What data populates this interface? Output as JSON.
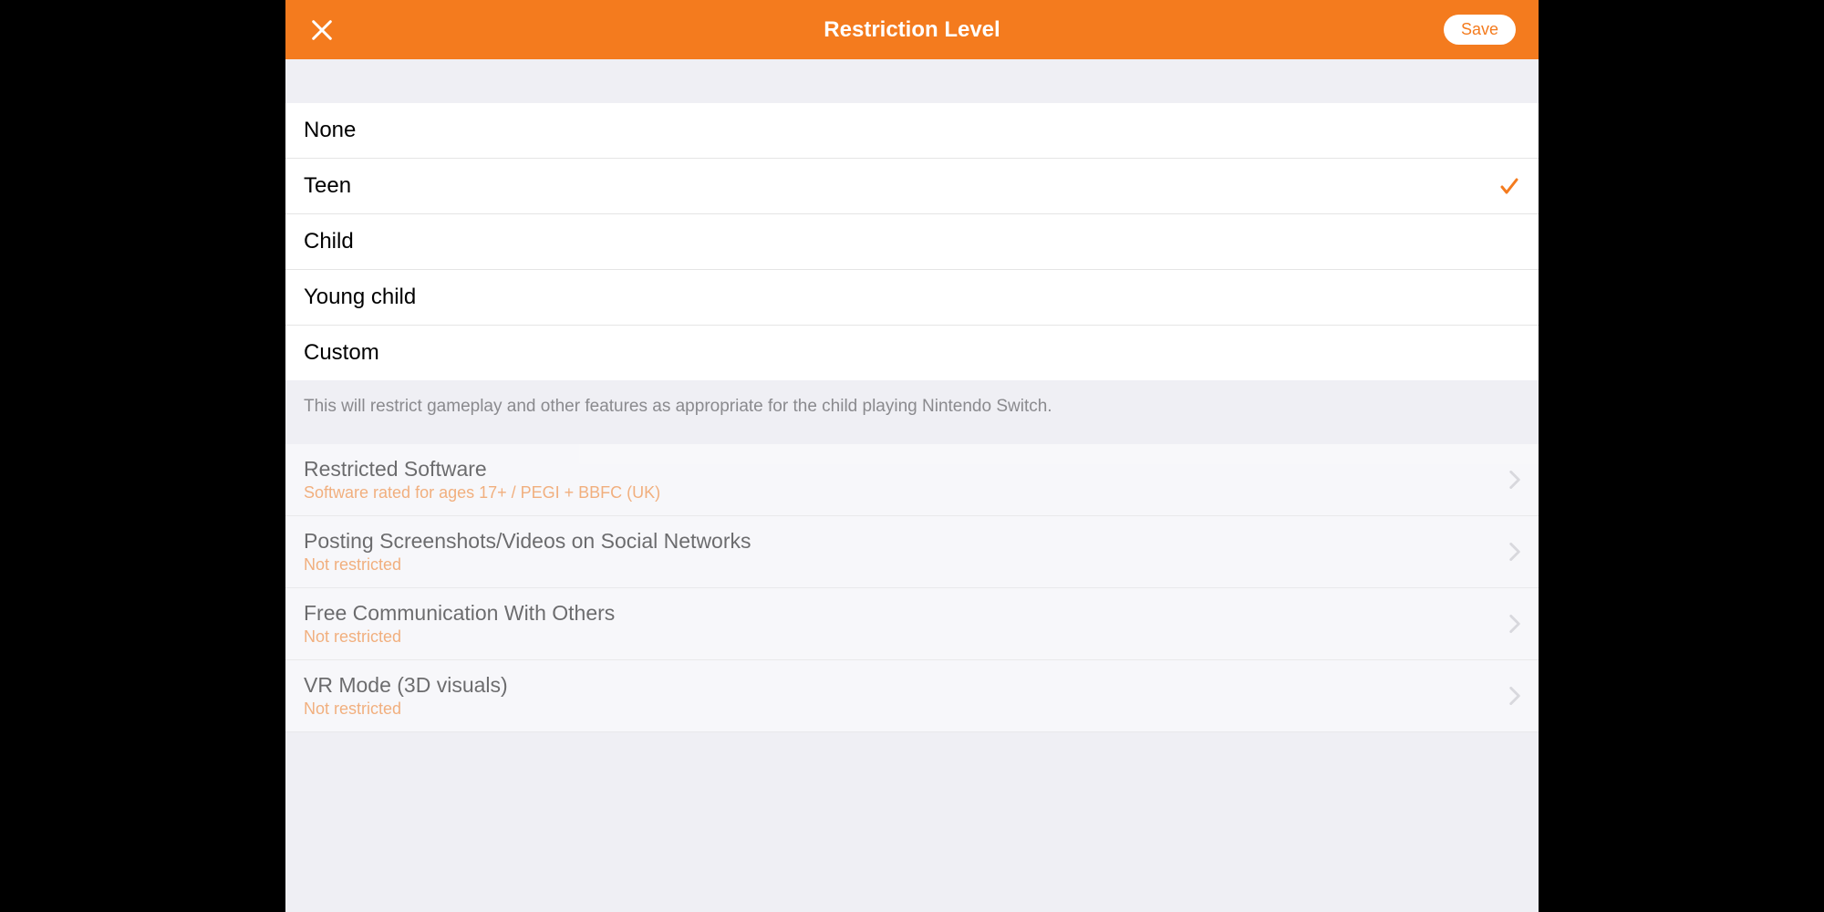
{
  "header": {
    "title": "Restriction Level",
    "save_label": "Save"
  },
  "levels": [
    {
      "label": "None",
      "selected": false
    },
    {
      "label": "Teen",
      "selected": true
    },
    {
      "label": "Child",
      "selected": false
    },
    {
      "label": "Young child",
      "selected": false
    },
    {
      "label": "Custom",
      "selected": false
    }
  ],
  "description": "This will restrict gameplay and other features as appropriate for the child playing Nintendo Switch.",
  "details": [
    {
      "title": "Restricted Software",
      "subtitle": "Software rated for ages 17+ / PEGI + BBFC (UK)"
    },
    {
      "title": "Posting Screenshots/Videos on Social Networks",
      "subtitle": "Not restricted"
    },
    {
      "title": "Free Communication With Others",
      "subtitle": "Not restricted"
    },
    {
      "title": "VR Mode (3D visuals)",
      "subtitle": "Not restricted"
    }
  ]
}
